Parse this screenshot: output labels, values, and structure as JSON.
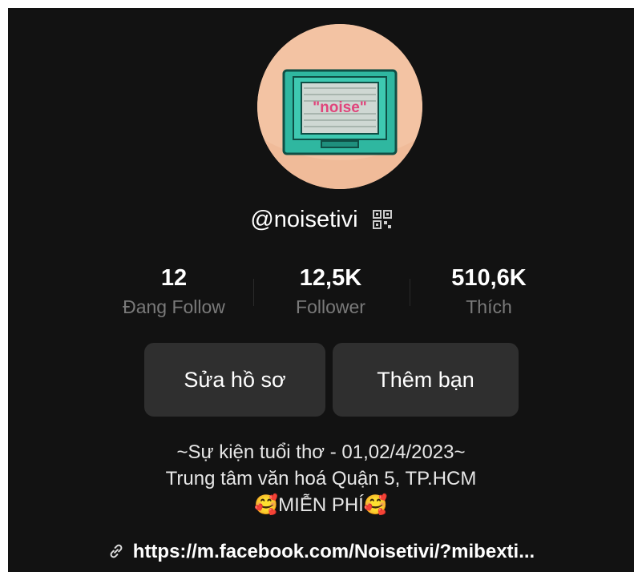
{
  "profile": {
    "username": "@noisetivi",
    "avatar_text": "\"noise\"",
    "stats": [
      {
        "value": "12",
        "label": "Đang Follow"
      },
      {
        "value": "12,5K",
        "label": "Follower"
      },
      {
        "value": "510,6K",
        "label": "Thích"
      }
    ],
    "buttons": {
      "edit_profile": "Sửa hồ sơ",
      "add_friend": "Thêm bạn"
    },
    "bio": {
      "line1": "~Sự kiện tuổi thơ - 01,02/4/2023~",
      "line2": "Trung tâm văn hoá Quận 5, TP.HCM",
      "line3_emoji_left": "🥰",
      "line3_text": "MIỄN PHÍ",
      "line3_emoji_right": "🥰"
    },
    "link": "https://m.facebook.com/Noisetivi/?mibexti..."
  },
  "icons": {
    "qr": "qr-code-icon",
    "link": "link-chain-icon"
  },
  "colors": {
    "background": "#121212",
    "avatar_bg": "#f3c3a3",
    "tv_body": "#2fb7a0",
    "button_bg": "#2f2f2f",
    "secondary_text": "#7a7a7a"
  }
}
